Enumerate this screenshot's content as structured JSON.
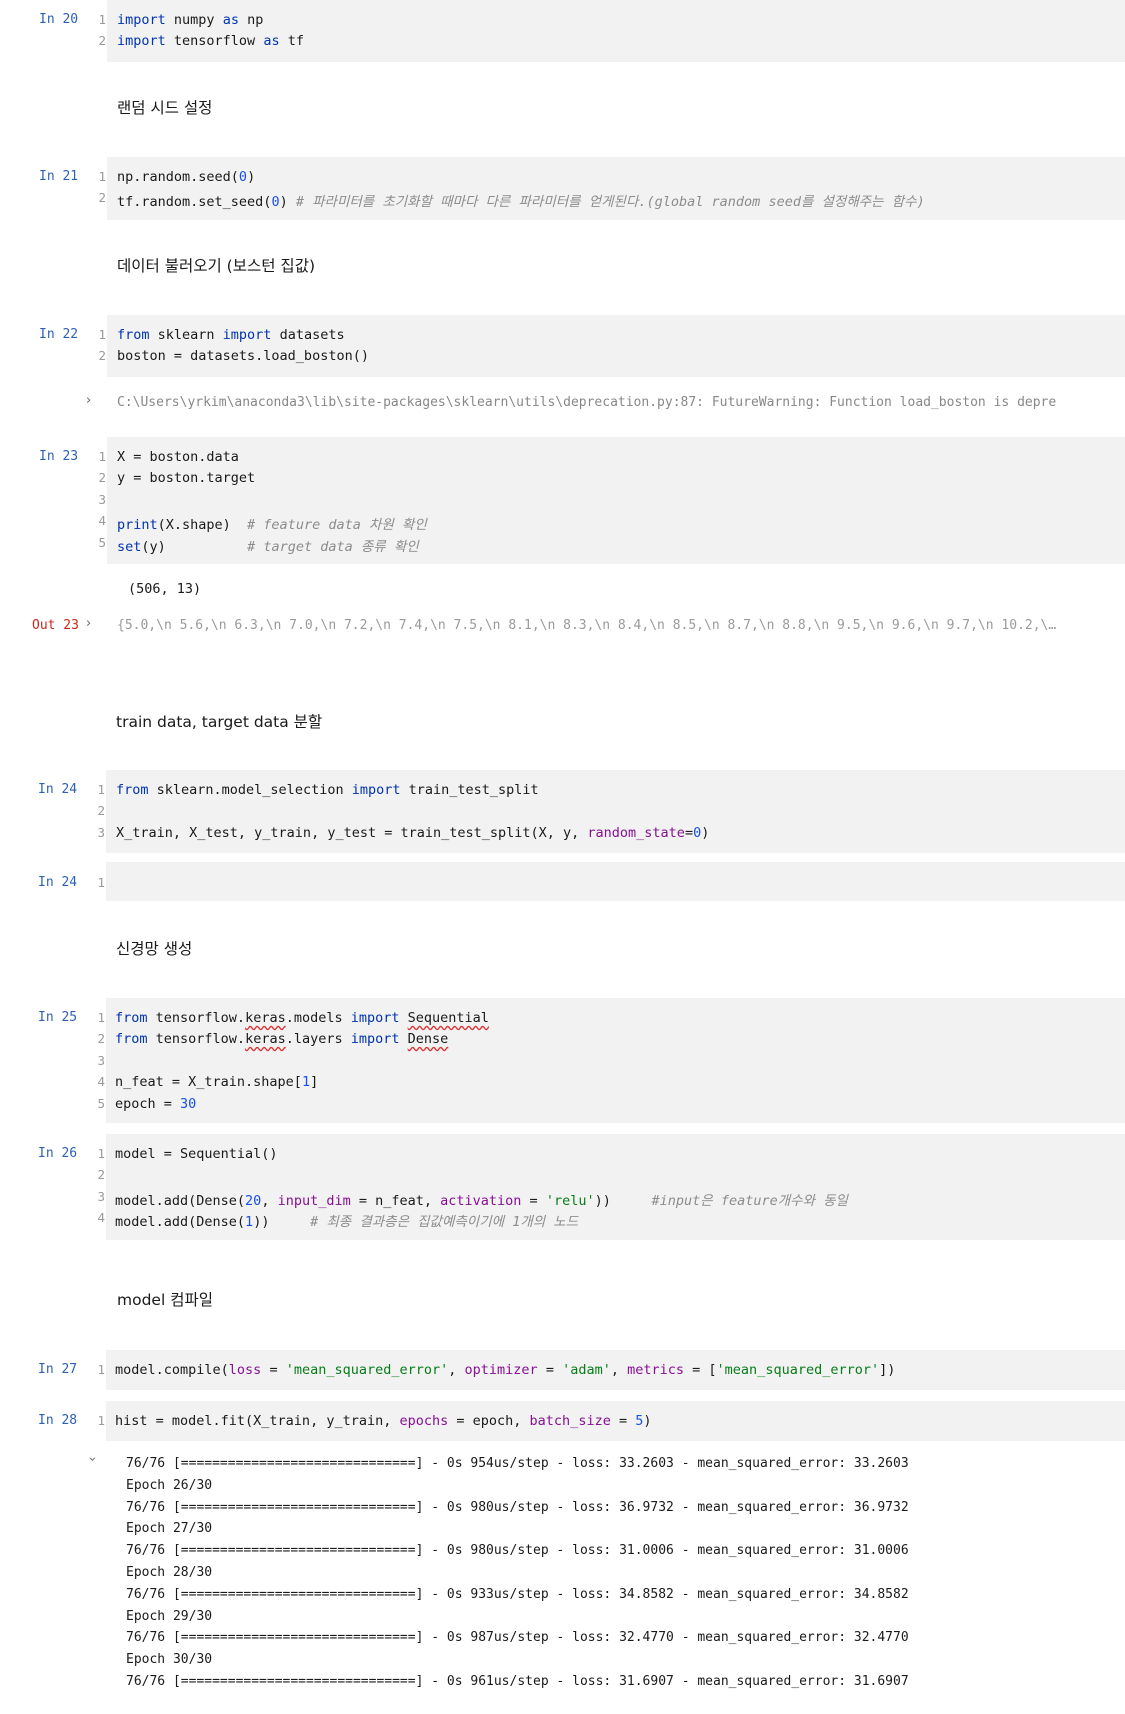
{
  "cells": {
    "c20": {
      "prompt": "In 20",
      "lines": [
        "1",
        "2"
      ],
      "code": [
        [
          {
            "t": "import",
            "c": "kw2"
          },
          {
            "t": " numpy "
          },
          {
            "t": "as",
            "c": "kw2"
          },
          {
            "t": " np"
          }
        ],
        [
          {
            "t": "import",
            "c": "kw2"
          },
          {
            "t": " tensorflow "
          },
          {
            "t": "as",
            "c": "kw2"
          },
          {
            "t": " tf"
          }
        ]
      ]
    },
    "md1": "랜덤 시드 설정",
    "c21": {
      "prompt": "In 21",
      "lines": [
        "1",
        "2"
      ],
      "code": [
        [
          {
            "t": "np.random.seed("
          },
          {
            "t": "0",
            "c": "num"
          },
          {
            "t": ")"
          }
        ],
        [
          {
            "t": "tf.random.set_seed("
          },
          {
            "t": "0",
            "c": "num"
          },
          {
            "t": ") "
          },
          {
            "t": "# 파라미터를 초기화할 때마다 다른 파라미터를 얻게된다.(global random seed를 설정해주는 함수)",
            "c": "cm"
          }
        ]
      ]
    },
    "md2": "데이터 불러오기 (보스턴 집값)",
    "c22": {
      "prompt": "In 22",
      "lines": [
        "1",
        "2"
      ],
      "code": [
        [
          {
            "t": "from",
            "c": "kw2"
          },
          {
            "t": " sklearn "
          },
          {
            "t": "import",
            "c": "kw2"
          },
          {
            "t": " datasets"
          }
        ],
        [
          {
            "t": "boston = datasets.load_boston()"
          }
        ]
      ],
      "warning": "C:\\Users\\yrkim\\anaconda3\\lib\\site-packages\\sklearn\\utils\\deprecation.py:87: FutureWarning: Function load_boston is depre"
    },
    "c23": {
      "prompt": "In 23",
      "lines": [
        "1",
        "2",
        "3",
        "4",
        "5"
      ],
      "code": [
        [
          {
            "t": "X = boston.data"
          }
        ],
        [
          {
            "t": "y = boston.target"
          }
        ],
        [
          {
            "t": ""
          }
        ],
        [
          {
            "t": "print",
            "c": "kw2"
          },
          {
            "t": "(X.shape)  "
          },
          {
            "t": "# feature data 차원 확인",
            "c": "cm"
          }
        ],
        [
          {
            "t": "set",
            "c": "kw2"
          },
          {
            "t": "(y)          "
          },
          {
            "t": "# target data 종류 확인",
            "c": "cm"
          }
        ]
      ],
      "stdout": "(506, 13)",
      "out_prompt": "Out 23",
      "out_text": "{5.0,\\n 5.6,\\n 6.3,\\n 7.0,\\n 7.2,\\n 7.4,\\n 7.5,\\n 8.1,\\n 8.3,\\n 8.4,\\n 8.5,\\n 8.7,\\n 8.8,\\n 9.5,\\n 9.6,\\n 9.7,\\n 10.2,\\…"
    },
    "md3": "train data, target data 분할",
    "c24": {
      "prompt": "In 24",
      "lines": [
        "1",
        "2",
        "3"
      ],
      "code": [
        [
          {
            "t": "from",
            "c": "kw2"
          },
          {
            "t": " sklearn.model_selection "
          },
          {
            "t": "import",
            "c": "kw2"
          },
          {
            "t": " train_test_split"
          }
        ],
        [
          {
            "t": ""
          }
        ],
        [
          {
            "t": "X_train, X_test, y_train, y_test = train_test_split(X, y, "
          },
          {
            "t": "random_state",
            "c": "param"
          },
          {
            "t": "="
          },
          {
            "t": "0",
            "c": "num"
          },
          {
            "t": ")"
          }
        ]
      ]
    },
    "c24b": {
      "prompt": "In 24",
      "lines": [
        "1"
      ]
    },
    "md4": "신경망 생성",
    "c25": {
      "prompt": "In 25",
      "lines": [
        "1",
        "2",
        "3",
        "4",
        "5"
      ],
      "code": [
        [
          {
            "t": "from",
            "c": "kw2"
          },
          {
            "t": " tensorflow."
          },
          {
            "t": "keras",
            "c": "und2"
          },
          {
            "t": ".models "
          },
          {
            "t": "import",
            "c": "kw2"
          },
          {
            "t": " "
          },
          {
            "t": "Sequential",
            "c": "und2"
          }
        ],
        [
          {
            "t": "from",
            "c": "kw2"
          },
          {
            "t": " tensorflow."
          },
          {
            "t": "keras",
            "c": "und2"
          },
          {
            "t": ".layers "
          },
          {
            "t": "import",
            "c": "kw2"
          },
          {
            "t": " "
          },
          {
            "t": "Dense",
            "c": "und2"
          }
        ],
        [
          {
            "t": ""
          }
        ],
        [
          {
            "t": "n_feat = X_train.shape["
          },
          {
            "t": "1",
            "c": "num"
          },
          {
            "t": "]"
          }
        ],
        [
          {
            "t": "epoch = "
          },
          {
            "t": "30",
            "c": "num"
          }
        ]
      ]
    },
    "c26": {
      "prompt": "In 26",
      "lines": [
        "1",
        "2",
        "3",
        "4"
      ],
      "code": [
        [
          {
            "t": "model = Sequential()"
          }
        ],
        [
          {
            "t": ""
          }
        ],
        [
          {
            "t": "model.add(Dense("
          },
          {
            "t": "20",
            "c": "num"
          },
          {
            "t": ", "
          },
          {
            "t": "input_dim",
            "c": "param"
          },
          {
            "t": " = n_feat, "
          },
          {
            "t": "activation",
            "c": "param"
          },
          {
            "t": " = "
          },
          {
            "t": "'relu'",
            "c": "str"
          },
          {
            "t": "))     "
          },
          {
            "t": "#input은 feature개수와 동일",
            "c": "cm"
          }
        ],
        [
          {
            "t": "model.add(Dense("
          },
          {
            "t": "1",
            "c": "num"
          },
          {
            "t": "))     "
          },
          {
            "t": "# 최종 결과층은 집값예측이기에 1개의 노드",
            "c": "cm"
          }
        ]
      ]
    },
    "md5": "model 컴파일",
    "c27": {
      "prompt": "In 27",
      "lines": [
        "1"
      ],
      "code": [
        [
          {
            "t": "model.compile("
          },
          {
            "t": "loss",
            "c": "param"
          },
          {
            "t": " = "
          },
          {
            "t": "'mean_squared_error'",
            "c": "str"
          },
          {
            "t": ", "
          },
          {
            "t": "optimizer",
            "c": "param"
          },
          {
            "t": " = "
          },
          {
            "t": "'adam'",
            "c": "str"
          },
          {
            "t": ", "
          },
          {
            "t": "metrics",
            "c": "param"
          },
          {
            "t": " = ["
          },
          {
            "t": "'mean_squared_error'",
            "c": "str"
          },
          {
            "t": "])"
          }
        ]
      ]
    },
    "c28": {
      "prompt": "In 28",
      "lines": [
        "1"
      ],
      "code": [
        [
          {
            "t": "hist = model.fit(X_train, y_train, "
          },
          {
            "t": "epochs",
            "c": "param"
          },
          {
            "t": " = epoch, "
          },
          {
            "t": "batch_size",
            "c": "param"
          },
          {
            "t": " = "
          },
          {
            "t": "5",
            "c": "num"
          },
          {
            "t": ")"
          }
        ]
      ],
      "log": [
        "76/76 [==============================] - 0s 954us/step - loss: 33.2603 - mean_squared_error: 33.2603",
        "Epoch 26/30",
        "76/76 [==============================] - 0s 980us/step - loss: 36.9732 - mean_squared_error: 36.9732",
        "Epoch 27/30",
        "76/76 [==============================] - 0s 980us/step - loss: 31.0006 - mean_squared_error: 31.0006",
        "Epoch 28/30",
        "76/76 [==============================] - 0s 933us/step - loss: 34.8582 - mean_squared_error: 34.8582",
        "Epoch 29/30",
        "76/76 [==============================] - 0s 987us/step - loss: 32.4770 - mean_squared_error: 32.4770",
        "Epoch 30/30",
        "76/76 [==============================] - 0s 961us/step - loss: 31.6907 - mean_squared_error: 31.6907"
      ]
    }
  }
}
